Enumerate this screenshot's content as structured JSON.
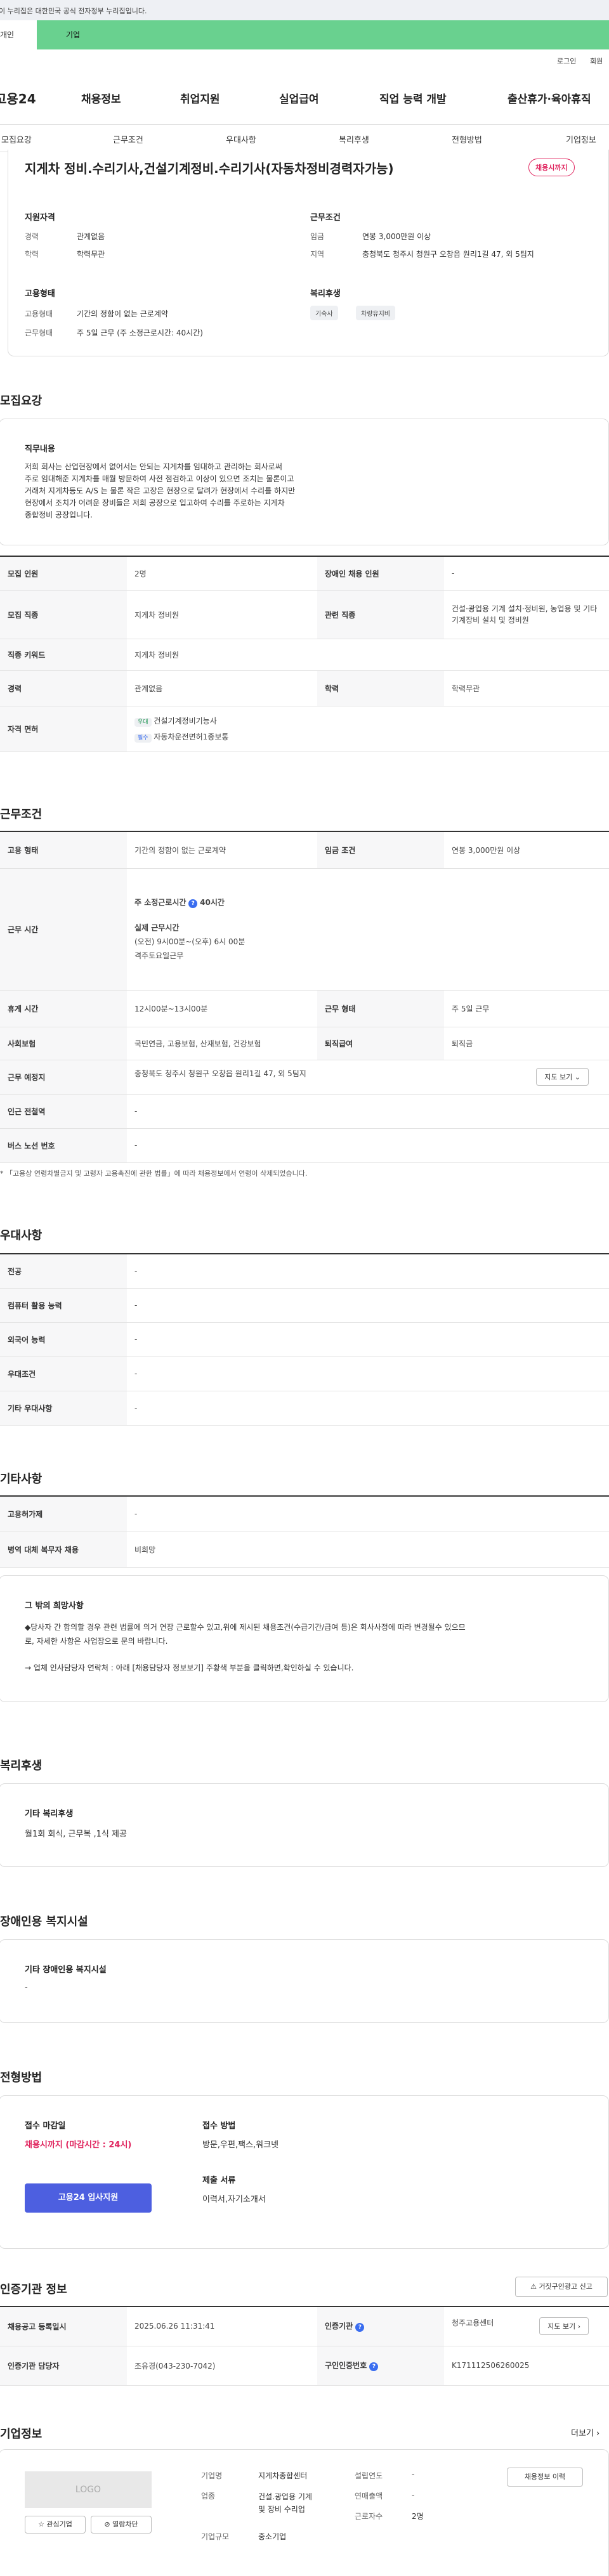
{
  "gov_banner": "이 누리집은 대한민국 공식 전자정부 누리집입니다.",
  "top_tabs": [
    "개인",
    "기업"
  ],
  "util": [
    "로그인",
    "회원"
  ],
  "logo": "고용24",
  "gnb": [
    "채용정보",
    "취업지원",
    "실업급여",
    "직업 능력 개발",
    "출산휴가·육아휴직"
  ],
  "snb": [
    "모집요강",
    "근무조건",
    "우대사항",
    "복리후생",
    "전형방법",
    "기업정보"
  ],
  "job": {
    "title": "지게차 정비.수리기사,건설기계정비.수리기사(자동차정비경력자가능)",
    "badge": "채용시까지",
    "qual_title": "지원자격",
    "career_l": "경력",
    "career_v": "관계없음",
    "edu_l": "학력",
    "edu_v": "학력무관",
    "cond_title": "근무조건",
    "wage_l": "임금",
    "wage_v": "연봉 3,000만원 이상",
    "loc_l": "지역",
    "loc_v": "충청북도 청주시 청원구 오창읍 원리1길 47, 외 5팀지",
    "emp_title": "고용형태",
    "emptype_l": "고용형태",
    "emptype_v": "기간의 정함이 없는 근로계약",
    "worktype_l": "근무형태",
    "worktype_v": "주 5일 근무 (주 소정근로시간: 40시간)",
    "welfare_title": "복리후생",
    "tags": [
      "기숙사",
      "차량유지비"
    ]
  },
  "recruit": {
    "title": "모집요강",
    "duty_title": "직무내용",
    "duty_text": [
      "저희 회사는 산업현장에서 없어서는 안되는 지게차를 임대하고 관리하는 회사로써",
      "주로 임대해준 지게차를 매월 방문하여 사전 점검하고 이상이 있으면 조치는 물론이고",
      "거래처 지게차등도 A/S 는 물론 작은 고장은 현장으로 달려가 현장에서 수리를 하지만",
      "현장에서 조치가 어려운 장비들은 저희 공장으로 입고하여 수리를 주로하는 지게차",
      "종합정비 공장입니다."
    ],
    "rows": [
      [
        "모집 인원",
        "2명",
        "장애인 채용 인원",
        "-"
      ],
      [
        "모집 직종",
        "지게차 정비원",
        "관련 직종",
        "건설·광업용 기계 설치·정비원, 농업용 및 기타 기계장비 설치 및 정비원"
      ],
      [
        "직종 키워드",
        "지게차 정비원",
        "",
        ""
      ],
      [
        "경력",
        "관계없음",
        "학력",
        "학력무관"
      ]
    ],
    "license_l": "자격 면허",
    "lic": [
      {
        "tag": "우대",
        "name": "건설기계정비기능사"
      },
      {
        "tag": "필수",
        "name": "자동차운전면허1종보통"
      }
    ]
  },
  "work": {
    "title": "근무조건",
    "emp_l": "고용 형태",
    "emp_v": "기간의 정함이 없는 근로계약",
    "wage_l": "임금 조건",
    "wage_v": "연봉 3,000만원 이상",
    "time_l": "근무 시간",
    "time_v1": "주 소정근로시간",
    "time_v1b": "40시간",
    "time_v2": "실제 근무시간",
    "time_v3": "(오전) 9시00분~(오후) 6시 00분",
    "time_v4": "격주토요일근무",
    "rest_l": "휴게 시간",
    "rest_v": "12시00분~13시00분",
    "form_l": "근무 형태",
    "form_v": "주 5일 근무",
    "ins_l": "사회보험",
    "ins_v": "국민연금, 고용보험, 산재보험, 건강보험",
    "ret_l": "퇴직급여",
    "ret_v": "퇴직금",
    "place_l": "근무 예정지",
    "place_v": "충청북도 청주시 청원구 오창읍 원리1길 47, 외 5팀지",
    "map_btn": "지도 보기",
    "sub_l": "인근 전철역",
    "sub_v": "-",
    "bus_l": "버스 노선 번호",
    "bus_v": "-",
    "note": "* 「고용상 연령차별금지 및 고령자 고용촉진에 관한 법률」에 따라 채용정보에서 연령이 삭제되었습니다."
  },
  "pref": {
    "title": "우대사항",
    "rows": [
      [
        "전공",
        "-"
      ],
      [
        "컴퓨터 활용 능력",
        "-"
      ],
      [
        "외국어 능력",
        "-"
      ],
      [
        "우대조건",
        "-"
      ],
      [
        "기타 우대사항",
        "-"
      ]
    ]
  },
  "etc": {
    "title": "기타사항",
    "rows": [
      [
        "고용허가제",
        "-"
      ],
      [
        "병역 대체 복무자 채용",
        "비희망"
      ]
    ],
    "box_title": "그 밖의 희망사항",
    "box_text1": "◆당사자 간 합의할 경우 관련 법률에 의거 연장 근로할수 있고,위에 제시된 채용조건(수급기간/급여 등)은 회사사정에 따라 변경될수 있으므",
    "box_text2": "로, 자세한 사항은 사업장으로 문의 바랍니다.",
    "box_text3": "→ 업체 인사담당자 연락처 : 아래 [채용담당자 정보보기] 주황색 부분을 클릭하면,확인하실 수 있습니다."
  },
  "welf": {
    "title": "복리후생",
    "sub": "기타 복리후생",
    "text": "월1회 회식, 근무복 ,1식 제공"
  },
  "dis": {
    "title": "장애인용 복지시설",
    "sub": "기타 장애인용 복지시설",
    "text": "-"
  },
  "sel": {
    "title": "전형방법",
    "deadline_l": "접수 마감일",
    "deadline_v": "채용시까지 (마감시간 : 24시)",
    "apply_btn": "고용24 입사지원",
    "method_l": "접수 방법",
    "method_v": "방문,우편,팩스,워크넷",
    "doc_l": "제출 서류",
    "doc_v": "이력서,자기소개서"
  },
  "cert": {
    "title": "인증기관 정보",
    "report_btn": "거짓구인광고 신고",
    "reg_l": "채용공고 등록일시",
    "reg_v": "2025.06.26 11:31:41",
    "org_l": "인증기관",
    "org_v": "청주고용센터",
    "map_btn": "지도 보기",
    "mgr_l": "인증기관 담당자",
    "mgr_v": "조유경(043-230-7042)",
    "no_l": "구인인증번호",
    "no_v": "K171112506260025"
  },
  "company": {
    "title": "기업정보",
    "more": "더보기",
    "logo": "LOGO",
    "fav_btn": "관심기업",
    "block_btn": "열람차단",
    "name_l": "기업명",
    "name_v": "지게차종합센터",
    "ind_l": "업종",
    "ind_v1": "건설.광업용 기계",
    "ind_v2": "및 장비 수리업",
    "size_l": "기업규모",
    "size_v": "중소기업",
    "est_l": "설립연도",
    "est_v": "-",
    "sales_l": "연매출액",
    "sales_v": "-",
    "emp_l": "근로자수",
    "emp_v": "2명",
    "hist_btn": "채용정보 이력"
  }
}
